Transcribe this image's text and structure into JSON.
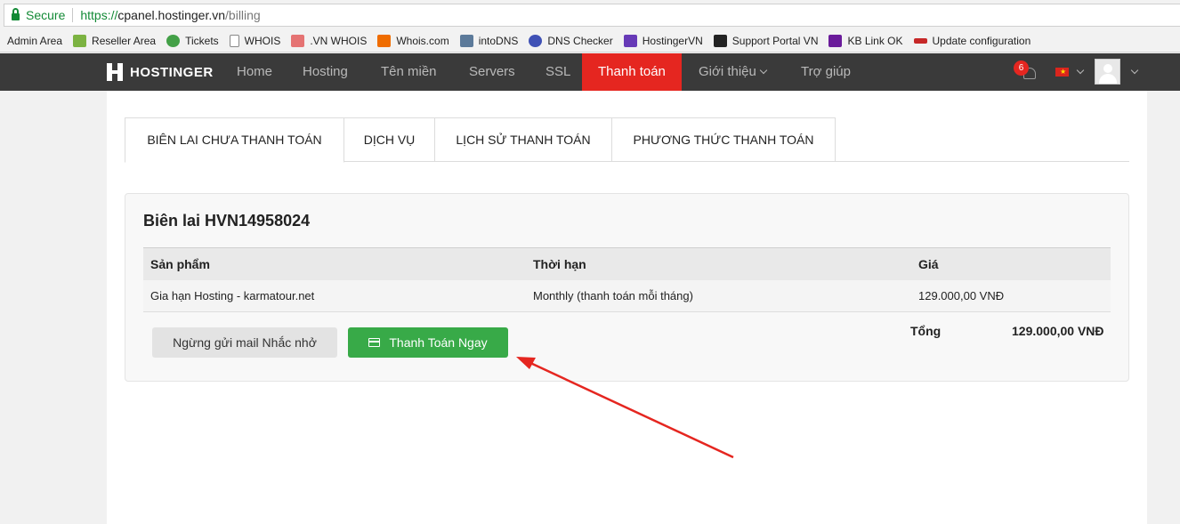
{
  "browser": {
    "secure_label": "Secure",
    "url_proto": "https://",
    "url_host": "cpanel.hostinger.vn",
    "url_path": "/billing",
    "bookmarks": [
      {
        "label": "Admin Area",
        "icon": "none",
        "color": ""
      },
      {
        "label": "Reseller Area",
        "icon": "reseller-icon",
        "color": "#7cb342"
      },
      {
        "label": "Tickets",
        "icon": "chat-bubble-icon",
        "color": "#43a047"
      },
      {
        "label": "WHOIS",
        "icon": "page-icon",
        "color": "#9e9e9e"
      },
      {
        "label": ".VN WHOIS",
        "icon": "vn-icon",
        "color": "#e57373"
      },
      {
        "label": "Whois.com",
        "icon": "whois-com-icon",
        "color": "#ef6c00"
      },
      {
        "label": "intoDNS",
        "icon": "dns-icon",
        "color": "#5c7a9a"
      },
      {
        "label": "DNS Checker",
        "icon": "globe-icon",
        "color": "#3f51b5"
      },
      {
        "label": "HostingerVN",
        "icon": "hostinger-icon",
        "color": "#673ab7"
      },
      {
        "label": "Support Portal VN",
        "icon": "book-icon",
        "color": "#222222"
      },
      {
        "label": "KB Link OK",
        "icon": "kb-icon",
        "color": "#6a1b9a"
      },
      {
        "label": "Update configuration",
        "icon": "update-icon",
        "color": "#c62828"
      }
    ]
  },
  "nav": {
    "brand": "HOSTINGER",
    "items": [
      "Home",
      "Hosting",
      "Tên miền",
      "Servers",
      "SSL",
      "Thanh toán",
      "Giới thiệu",
      "Trợ giúp"
    ],
    "active": "Thanh toán",
    "notification_count": "6"
  },
  "tabs": [
    "BIÊN LAI CHƯA THANH TOÁN",
    "DỊCH VỤ",
    "LỊCH SỬ THANH TOÁN",
    "PHƯƠNG THỨC THANH TOÁN"
  ],
  "invoice": {
    "title": "Biên lai HVN14958024",
    "columns": [
      "Sản phẩm",
      "Thời hạn",
      "Giá"
    ],
    "rows": [
      [
        "Gia hạn Hosting - karmatour.net",
        "Monthly (thanh toán mỗi tháng)",
        "129.000,00 VNĐ"
      ]
    ],
    "stop_reminder_label": "Ngừng gửi mail Nhắc nhở",
    "pay_now_label": "Thanh Toán Ngay",
    "total_label": "Tổng",
    "total_value": "129.000,00 VNĐ"
  },
  "colors": {
    "nav_bg": "#3a3a3a",
    "nav_active": "#e52620",
    "pay_button": "#38aa48",
    "annotation_arrow": "#e52620"
  }
}
